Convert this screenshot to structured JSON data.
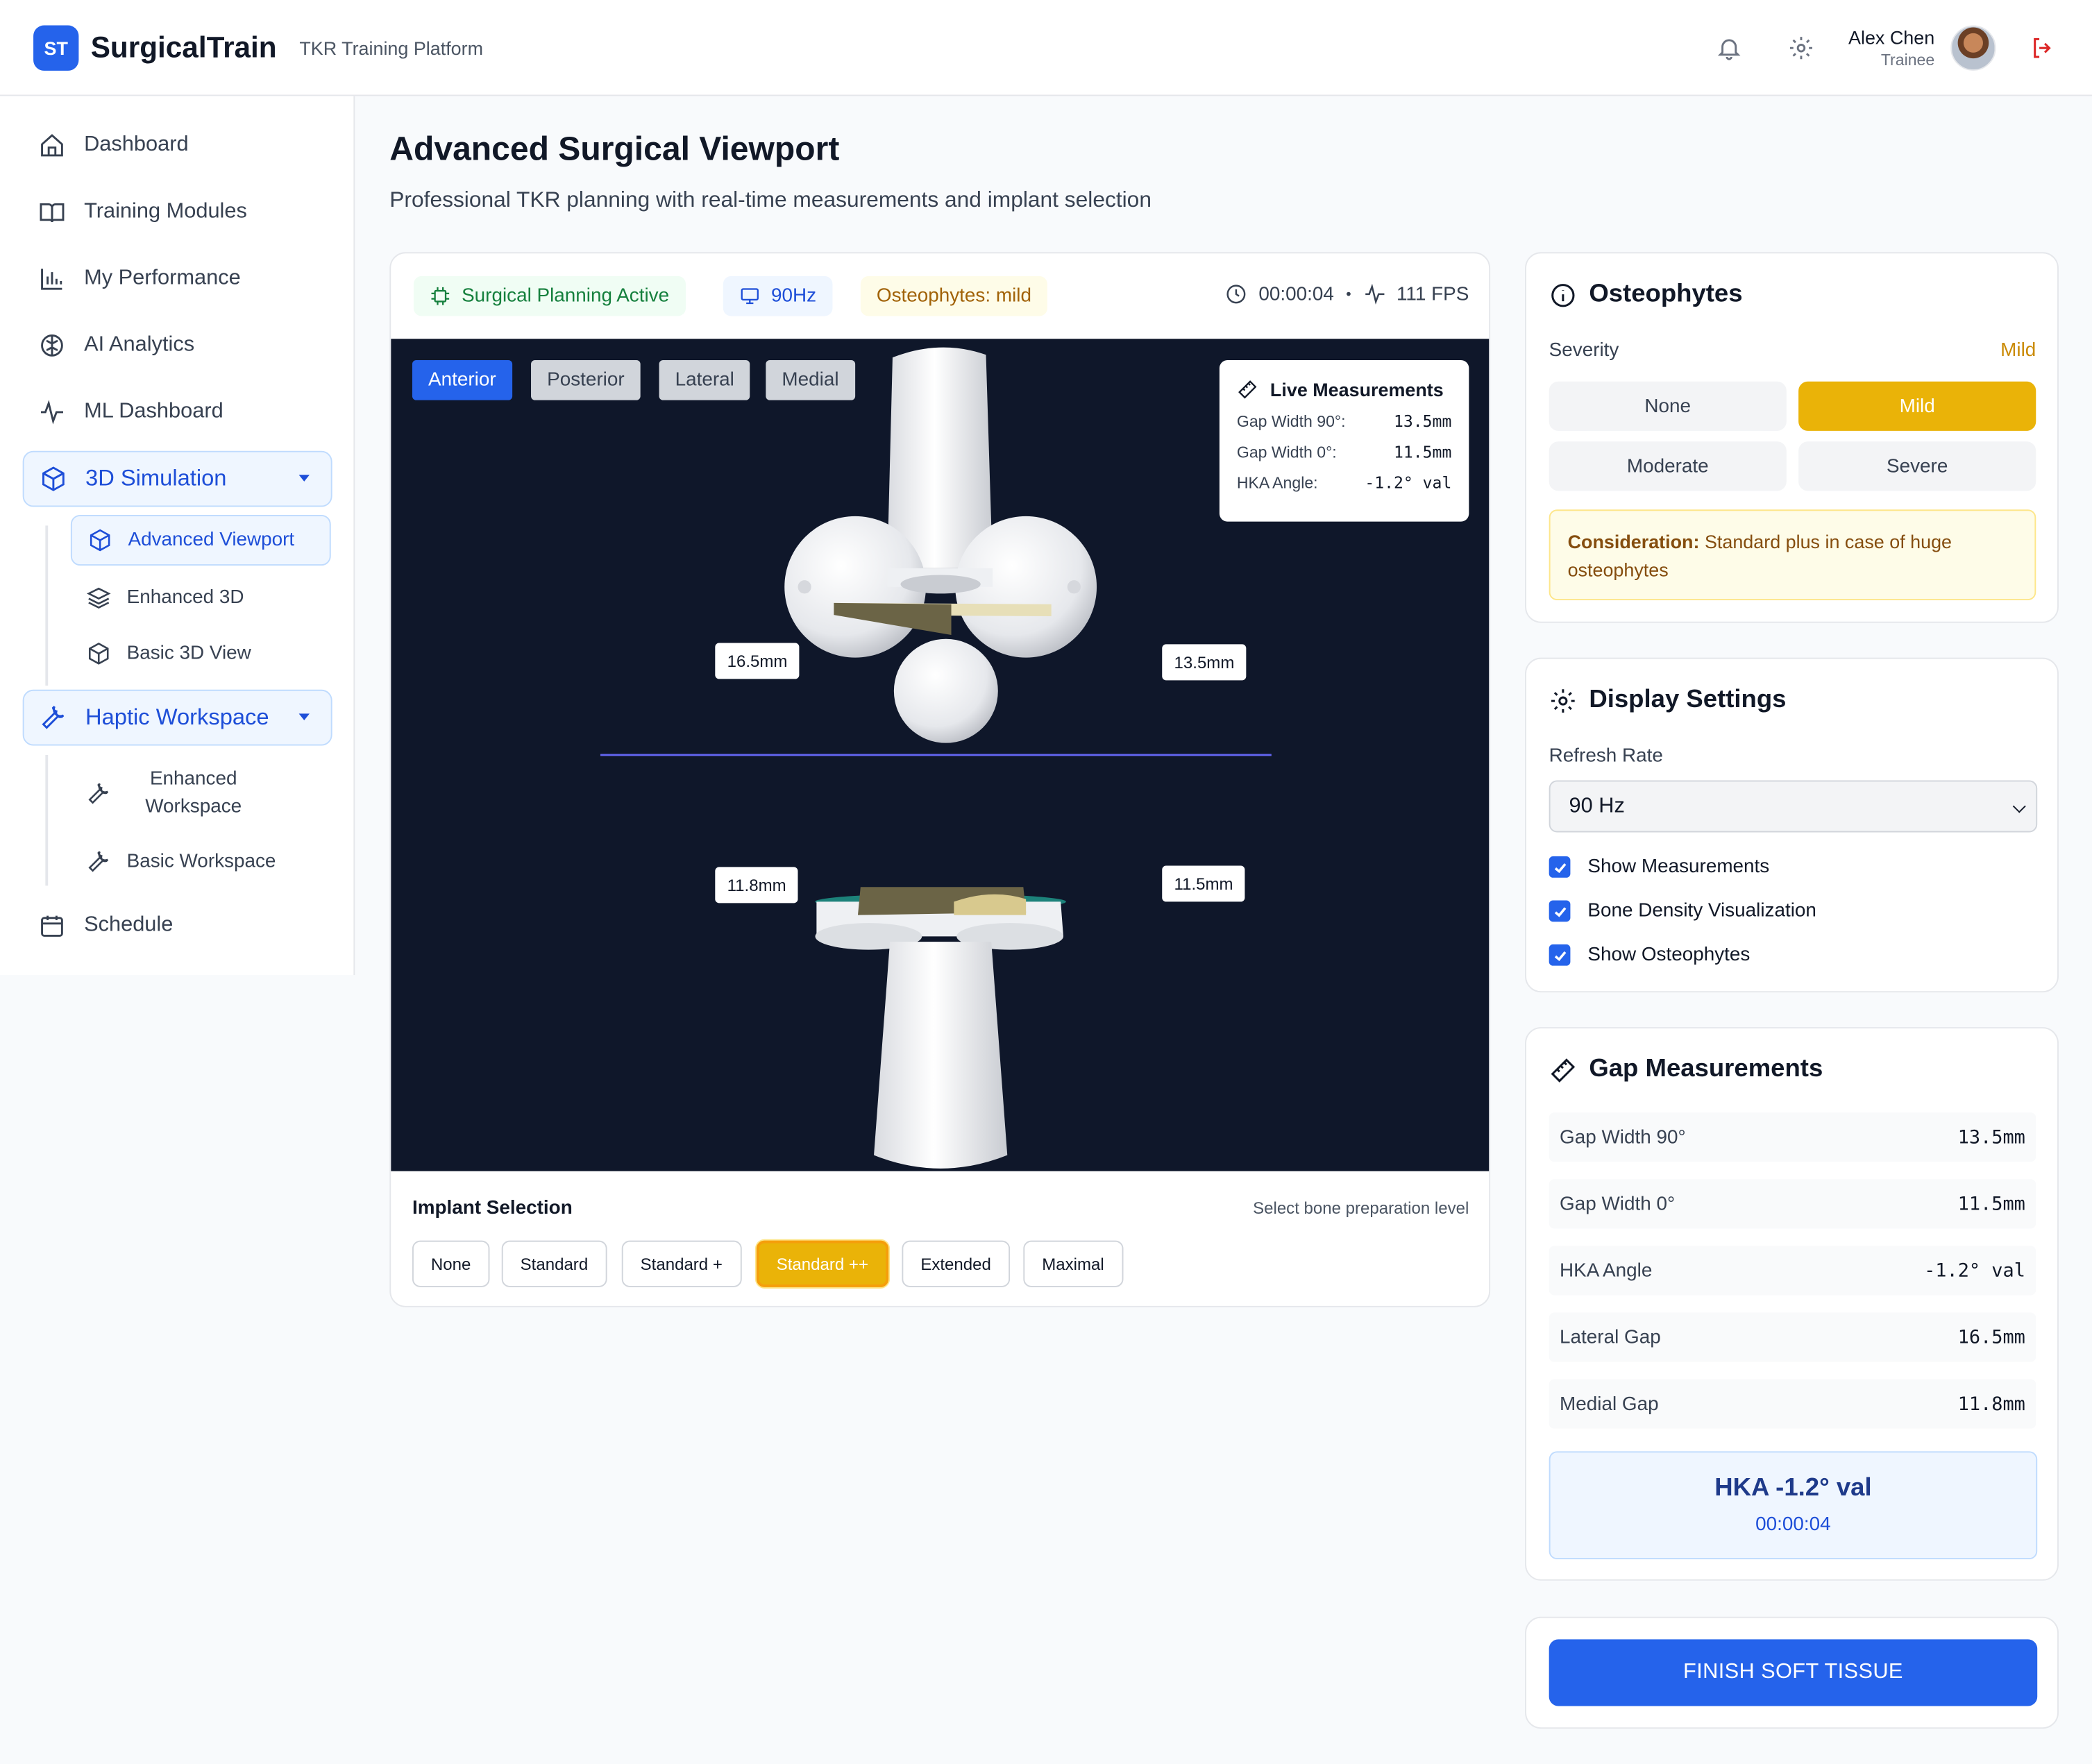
{
  "header": {
    "logo": "ST",
    "brand": "SurgicalTrain",
    "subtitle": "TKR Training Platform",
    "user_name": "Alex Chen",
    "user_role": "Trainee"
  },
  "sidebar": {
    "dashboard": "Dashboard",
    "training_modules": "Training Modules",
    "my_performance": "My Performance",
    "ai_analytics": "AI Analytics",
    "ml_dashboard": "ML Dashboard",
    "simulation": {
      "label": "3D Simulation",
      "items": [
        "Advanced Viewport",
        "Enhanced 3D",
        "Basic 3D View"
      ]
    },
    "haptic": {
      "label": "Haptic Workspace",
      "items": [
        "Enhanced Workspace",
        "Basic Workspace"
      ]
    },
    "schedule": "Schedule"
  },
  "page": {
    "title": "Advanced Surgical Viewport",
    "subtitle": "Professional TKR planning with real-time measurements and implant selection"
  },
  "status": {
    "planning": "Surgical Planning Active",
    "refresh": "90Hz",
    "osteophytes": "Osteophytes: mild",
    "timer": "00:00:04",
    "separator": "•",
    "fps": "111 FPS"
  },
  "views": [
    "Anterior",
    "Posterior",
    "Lateral",
    "Medial"
  ],
  "live_measurements": {
    "title": "Live Measurements",
    "rows": [
      {
        "label": "Gap Width 90°:",
        "value": "13.5mm"
      },
      {
        "label": "Gap Width 0°:",
        "value": "11.5mm"
      },
      {
        "label": "HKA Angle:",
        "value": "-1.2° val"
      }
    ]
  },
  "overlay_labels": {
    "upper_left": "16.5mm",
    "upper_right": "13.5mm",
    "lower_left": "11.8mm",
    "lower_right": "11.5mm"
  },
  "implant": {
    "title": "Implant Selection",
    "hint": "Select bone preparation level",
    "options": [
      "None",
      "Standard",
      "Standard +",
      "Standard ++",
      "Extended",
      "Maximal"
    ],
    "selected": "Standard ++"
  },
  "osteophytes_panel": {
    "title": "Osteophytes",
    "severity_label": "Severity",
    "severity_value": "Mild",
    "options": [
      "None",
      "Mild",
      "Moderate",
      "Severe"
    ],
    "consider_label": "Consideration:",
    "consider_text": "Standard plus in case of huge osteophytes"
  },
  "display_settings": {
    "title": "Display Settings",
    "refresh_label": "Refresh Rate",
    "refresh_value": "90 Hz",
    "checks": [
      "Show Measurements",
      "Bone Density Visualization",
      "Show Osteophytes"
    ]
  },
  "gap_panel": {
    "title": "Gap Measurements",
    "rows": [
      {
        "label": "Gap Width 90°",
        "value": "13.5mm"
      },
      {
        "label": "Gap Width 0°",
        "value": "11.5mm"
      },
      {
        "label": "HKA Angle",
        "value": "-1.2° val"
      },
      {
        "label": "Lateral Gap",
        "value": "16.5mm"
      },
      {
        "label": "Medial Gap",
        "value": "11.8mm"
      }
    ],
    "hka": "HKA -1.2° val",
    "time": "00:00:04"
  },
  "finish_label": "FINISH SOFT TISSUE",
  "colors": {
    "primary": "#2563eb",
    "accent": "#eab308",
    "viewport_bg": "#0f172a"
  }
}
